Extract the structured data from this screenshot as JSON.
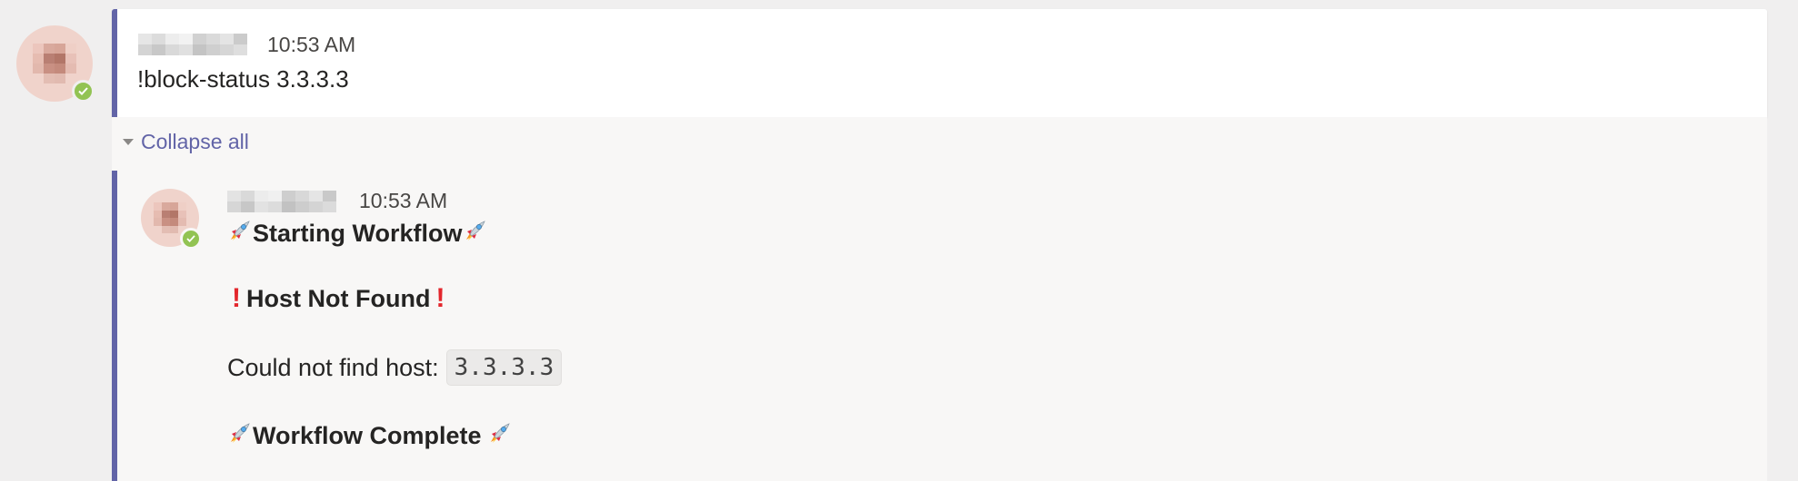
{
  "top_message": {
    "timestamp": "10:53 AM",
    "text": "!block-status 3.3.3.3"
  },
  "thread": {
    "collapse_label": "Collapse all",
    "reply": {
      "timestamp": "10:53 AM",
      "starting_label": "Starting Workflow",
      "host_not_found_label": "Host Not Found",
      "could_not_find_label": "Could not find host:",
      "host_value": "3.3.3.3",
      "complete_label": "Workflow Complete"
    }
  },
  "icons": {
    "presence": "available-check-icon",
    "rocket": "rocket-icon",
    "exclamation": "red-exclamation-icon",
    "collapse": "chevron-down-icon"
  },
  "colors": {
    "accent": "#6264a7",
    "presence": "#92c353",
    "alert": "#e3262c"
  }
}
